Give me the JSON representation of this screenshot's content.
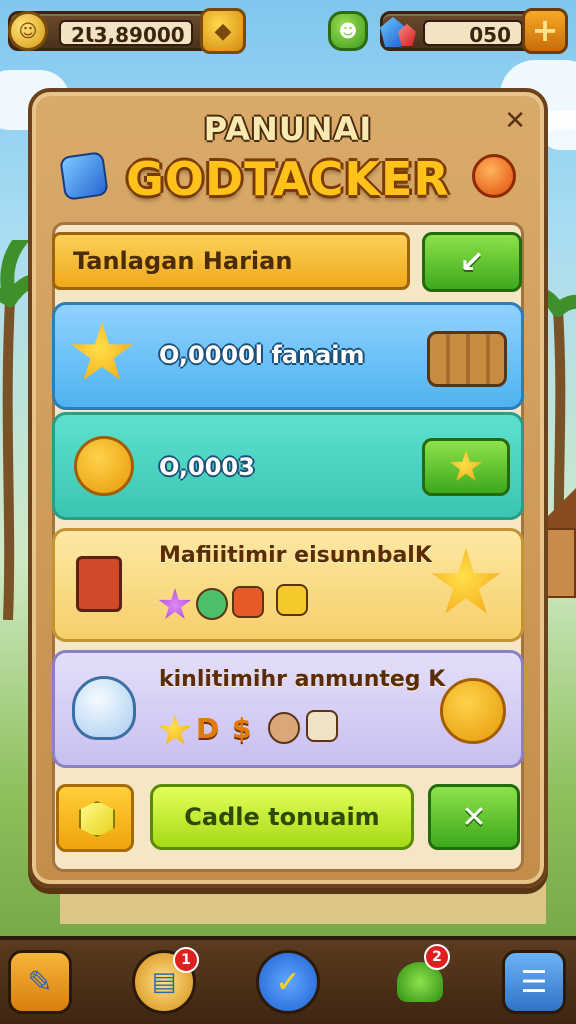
{
  "top_bar": {
    "gold_amount": "2Ɩ3,89000",
    "gem_amount": "050",
    "add_label": "+"
  },
  "panel": {
    "subtitle": "PANUNAI",
    "title": "GODTACKER",
    "close_label": "✕"
  },
  "daily": {
    "tab_label": "Tanlagan Harian",
    "claim_icon": "arrow-icon"
  },
  "quests": [
    {
      "text": "O,0000l fanaim",
      "reward_icon": "wood-logs-icon"
    },
    {
      "text": "O,0003",
      "action_icon": "star-icon"
    },
    {
      "text": "Mafiiitimir eisunnbalK"
    },
    {
      "text": "kinlitimihr anmunteg K"
    }
  ],
  "footer": {
    "collect_label": "Cadle tonuaim",
    "confirm_icon": "check-icon"
  },
  "bottom_nav": [
    {
      "name": "tools",
      "icon": "pencil-ruler-icon"
    },
    {
      "name": "tasks",
      "icon": "notes-icon",
      "badge": "1"
    },
    {
      "name": "home",
      "icon": "check-circle-icon"
    },
    {
      "name": "shop",
      "icon": "green-bell-icon",
      "badge": "2"
    },
    {
      "name": "menu",
      "icon": "menu-icon"
    }
  ],
  "colors": {
    "panel_wood": "#c48d4a",
    "title_gold": "#ffc21a",
    "button_green": "#3da81c",
    "badge_red": "#e02020"
  }
}
